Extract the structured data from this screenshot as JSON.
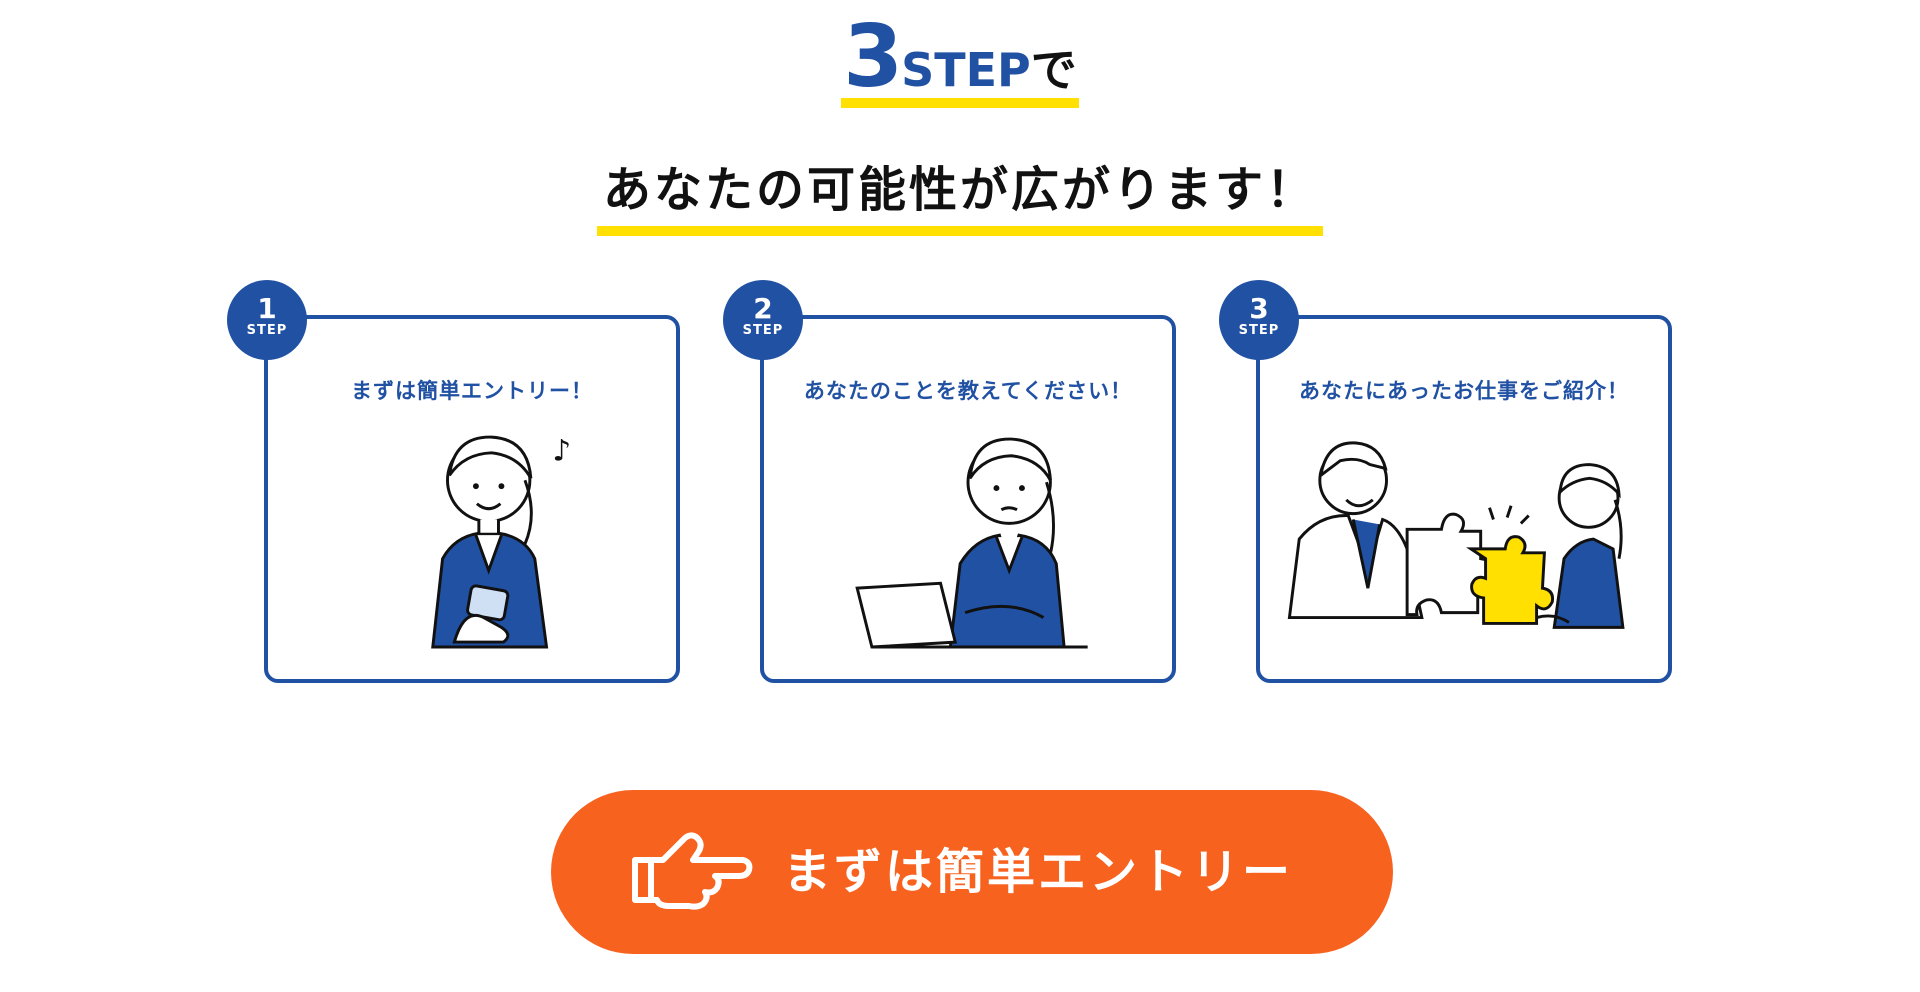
{
  "heading": {
    "number": "3",
    "step_word": "STEP",
    "suffix": "で",
    "subtitle": "あなたの可能性が広がります！"
  },
  "steps": [
    {
      "number": "1",
      "label": "STEP",
      "title": "まずは簡単エントリー！",
      "illustration": "woman-with-smartphone-icon"
    },
    {
      "number": "2",
      "label": "STEP",
      "title": "あなたのことを教えてください！",
      "illustration": "woman-with-laptop-icon"
    },
    {
      "number": "3",
      "label": "STEP",
      "title": "あなたにあったお仕事をご紹介！",
      "illustration": "puzzle-handshake-icon"
    }
  ],
  "cta": {
    "label": "まずは簡単エントリー",
    "icon": "pointing-hand-icon"
  },
  "colors": {
    "primary_blue": "#2151a3",
    "accent_yellow": "#ffe000",
    "cta_orange": "#f8621f"
  }
}
